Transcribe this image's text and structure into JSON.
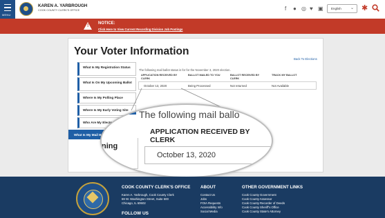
{
  "header": {
    "menu_label": "MENU",
    "org_name": "KAREN A. YARBROUGH",
    "org_subtitle": "COOK COUNTY CLERK'S OFFICE",
    "social_icons": [
      "facebook-icon",
      "flickr-icon",
      "instagram-icon",
      "twitter-icon",
      "youtube-icon"
    ],
    "language": "English"
  },
  "notice": {
    "title": "NOTICE:",
    "link": "Click Here to View Current Recording Division Job Postings"
  },
  "main": {
    "title": "Your Voter Information",
    "back_link": "Back To Elections"
  },
  "sidebar": {
    "items": [
      {
        "label": "What Is My Registration Status",
        "active": false
      },
      {
        "label": "What Is On My Upcoming Ballot",
        "active": false
      },
      {
        "label": "Where Is My Polling Place",
        "active": false
      },
      {
        "label": "Where Is My Early Voting Site",
        "active": false
      },
      {
        "label": "Who Are My Elected Offi",
        "active": false
      },
      {
        "label": "What Is My Mail B",
        "active": true
      }
    ]
  },
  "status": {
    "intro": "The following mail ballot status is for for the November 3, 2020 election.",
    "columns": [
      "APPLICATION RECEIVED BY CLERK",
      "BALLOT MAILED TO YOU",
      "BALLOT RECEIVED BY CLERK",
      "TRACK MY BALLOT"
    ],
    "row": [
      "October 13, 2020",
      "Being Processed",
      "Not returned",
      "Not Available"
    ]
  },
  "zoom": {
    "intro": "The following mail ballo",
    "header": "APPLICATION RECEIVED BY CLERK",
    "value": "October 13, 2020",
    "side_fragment": "ning"
  },
  "footer": {
    "col1_title": "COOK COUNTY CLERK'S OFFICE",
    "col1_lines": [
      "Karen A. Yarbrough, Cook County Clerk",
      "69 W. Washington Street, Suite 500",
      "Chicago, IL 60602"
    ],
    "follow_us": "FOLLOW US",
    "col2_title": "ABOUT",
    "col2_links": [
      "Contact Us",
      "Jobs",
      "FOIA Requests",
      "Accessibility Info",
      "Social Media"
    ],
    "col3_title": "OTHER GOVERNMENT LINKS",
    "col3_links": [
      "Cook County Government",
      "Cook County Assessor",
      "Cook County Recorder of Deeds",
      "Cook County Sheriff's Office",
      "Cook County State's Attorney"
    ]
  },
  "colors": {
    "brand_blue": "#1f5fa6",
    "notice_red": "#c23a28",
    "footer_navy": "#1a3b62",
    "seal_gold": "#c7a23a"
  }
}
